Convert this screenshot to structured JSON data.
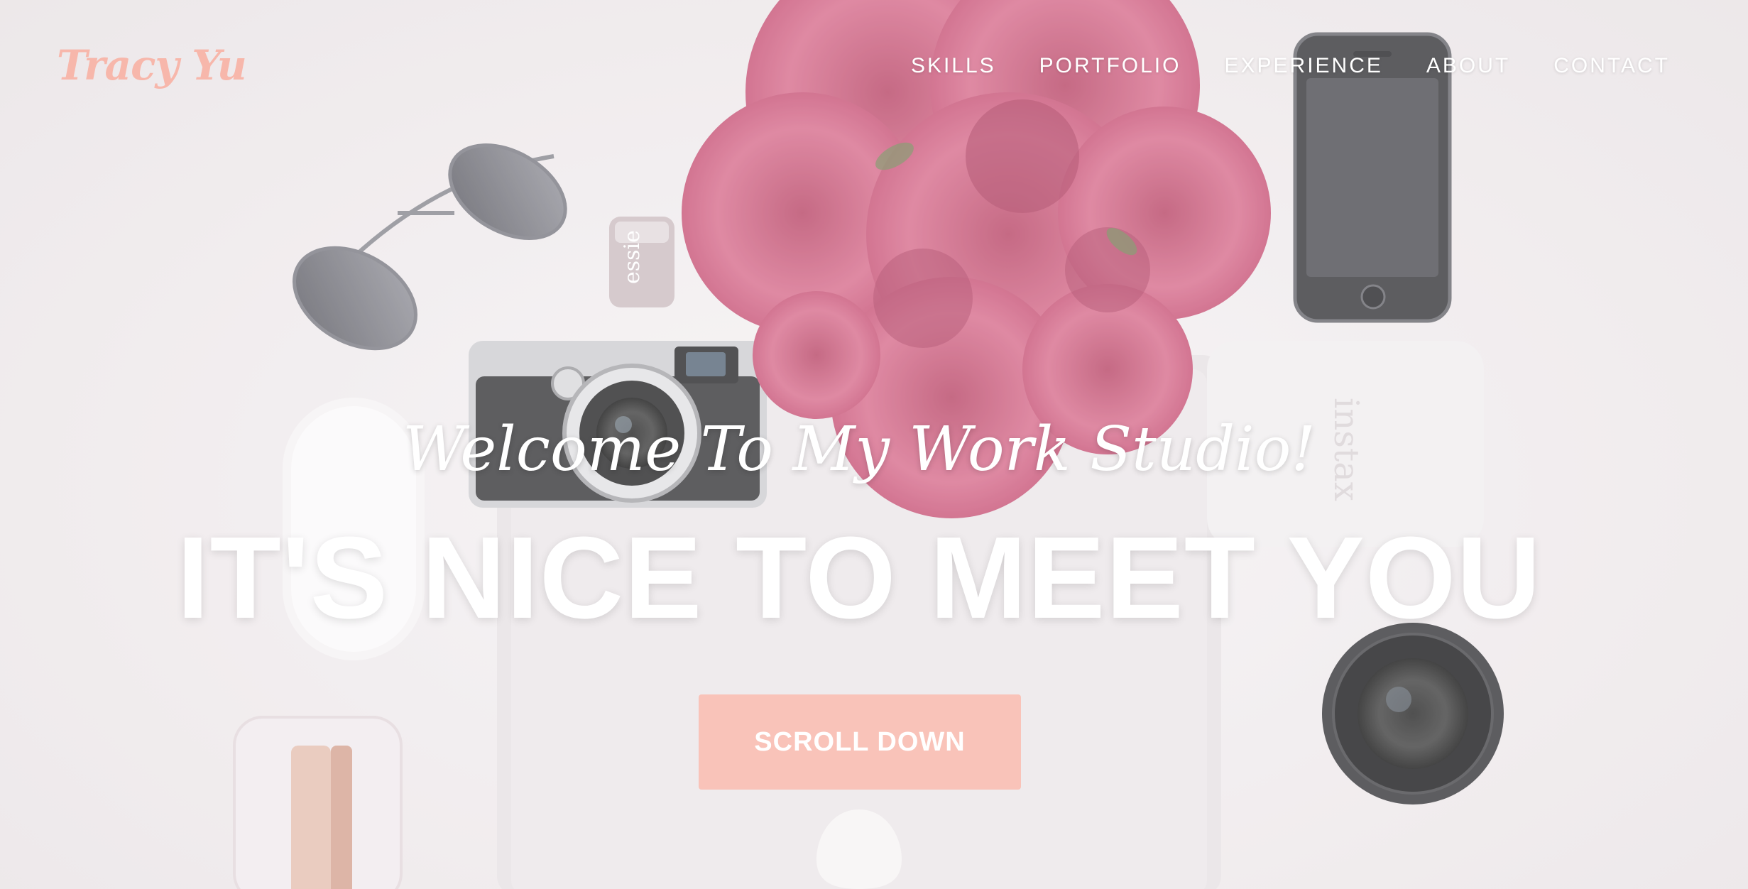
{
  "header": {
    "brand": "Tracy Yu",
    "nav": [
      {
        "label": "SKILLS"
      },
      {
        "label": "PORTFOLIO"
      },
      {
        "label": "EXPERIENCE"
      },
      {
        "label": "ABOUT"
      },
      {
        "label": "CONTACT"
      }
    ]
  },
  "hero": {
    "subtitle": "Welcome To My Work Studio!",
    "headline": "IT'S NICE TO MEET YOU",
    "cta_label": "SCROLL DOWN",
    "background_icons": [
      "sunglasses-icon",
      "nail-polish-icon",
      "camera-icon",
      "peony-bouquet-icon",
      "smartphone-icon",
      "instax-camera-icon",
      "mouse-icon",
      "laptop-icon",
      "lens-icon",
      "stapler-icon"
    ]
  },
  "colors": {
    "brand": "#f7b7ab",
    "cta": "#f9c3b9",
    "nav_text": "#ffffff",
    "background": "#efeaec"
  }
}
